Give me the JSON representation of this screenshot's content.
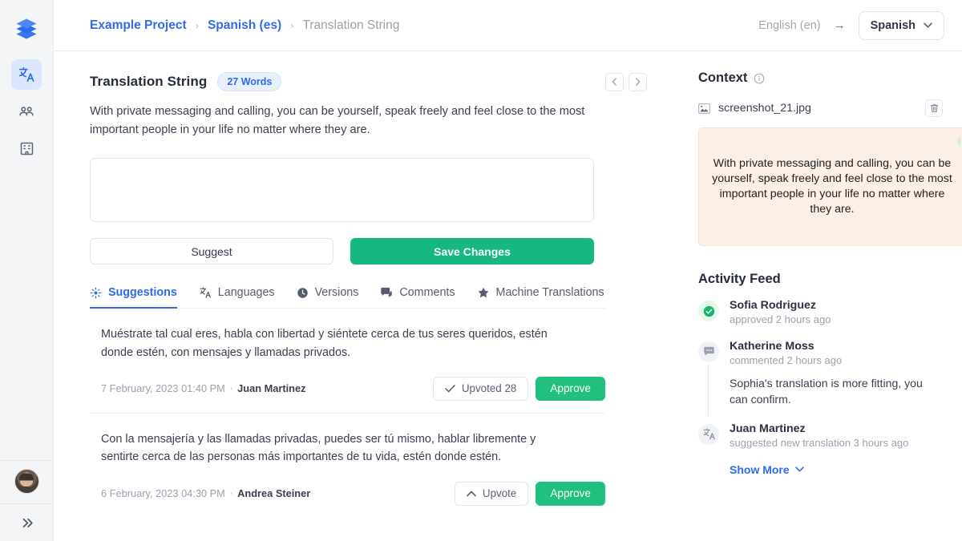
{
  "colors": {
    "accent_blue": "#2f6bed",
    "green_save": "#17b87f",
    "green_approve": "#22c07e",
    "context_bg": "#fcefe5",
    "rail_bg": "#f4f5f7"
  },
  "rail": {
    "logo": "layers-logo-icon",
    "items": [
      {
        "name": "translations",
        "icon": "translate-icon",
        "active": true
      },
      {
        "name": "team",
        "icon": "people-icon",
        "active": false
      },
      {
        "name": "organization",
        "icon": "building-icon",
        "active": false
      }
    ],
    "avatar": "user-avatar",
    "expand": "chevron-double-right-icon"
  },
  "header": {
    "breadcrumb": [
      {
        "label": "Example Project",
        "current": false
      },
      {
        "label": "Spanish (es)",
        "current": false
      },
      {
        "label": "Translation String",
        "current": true
      }
    ],
    "separator": "›",
    "source_language": "English (en)",
    "arrow": "→",
    "target_language": "Spanish"
  },
  "main": {
    "title": "Translation String",
    "words_badge": "27 Words",
    "prev_label": "‹",
    "next_label": "›",
    "source_text": "With private messaging and calling, you can be yourself, speak freely and feel close to the most important people in your life no matter where they are.",
    "editor_value": "",
    "editor_placeholder": "",
    "suggest_label": "Suggest",
    "save_label": "Save Changes",
    "tabs": [
      {
        "label": "Suggestions",
        "icon": "sparkle-icon",
        "active": true
      },
      {
        "label": "Languages",
        "icon": "translate-icon",
        "active": false
      },
      {
        "label": "Versions",
        "icon": "clock-icon",
        "active": false
      },
      {
        "label": "Comments",
        "icon": "comment-icon",
        "active": false
      },
      {
        "label": "Machine Translations",
        "icon": "star-icon",
        "active": false
      }
    ],
    "suggestions": [
      {
        "text": "Muéstrate tal cual eres, habla con libertad y siéntete cerca de tus seres queridos, estén donde estén, con mensajes y llamadas privados.",
        "date": "7 February, 2023 01:40 PM",
        "dot": "·",
        "author": "Juan Martinez",
        "upvote_label": "Upvoted 28",
        "upvote_icon": "check-icon",
        "upvoted": true,
        "approve_label": "Approve"
      },
      {
        "text": "Con la mensajería y las llamadas privadas, puedes ser tú mismo, hablar libremente y sentirte cerca de las personas más importantes de tu vida, estén donde estén.",
        "date": "6 February, 2023 04:30 PM",
        "dot": "·",
        "author": "Andrea Steiner",
        "upvote_label": "Upvote",
        "upvote_icon": "chevron-up-icon",
        "upvoted": false,
        "approve_label": "Approve"
      }
    ]
  },
  "aside": {
    "context_title": "Context",
    "context_info_icon": "info-icon",
    "file_name": "screenshot_21.jpg",
    "file_icon": "image-icon",
    "delete_icon": "trash-icon",
    "preview_text": "With private messaging and calling, you can be yourself, speak freely and feel close to the most important people in your life no matter where they are.",
    "feed_title": "Activity Feed",
    "feed": [
      {
        "name": "Sofia Rodriguez",
        "action": "approved 2 hours ago",
        "icon": "check-circle-icon",
        "icon_style": "ok",
        "comment": ""
      },
      {
        "name": "Katherine Moss",
        "action": "commented 2 hours ago",
        "icon": "comment-icon",
        "icon_style": "plain",
        "comment": "Sophia's translation is more fitting, you can confirm."
      },
      {
        "name": "Juan Martinez",
        "action": "suggested new translation 3 hours ago",
        "icon": "translate-icon",
        "icon_style": "plain",
        "comment": ""
      }
    ],
    "show_more": "Show More",
    "show_more_icon": "chevron-down-icon"
  }
}
